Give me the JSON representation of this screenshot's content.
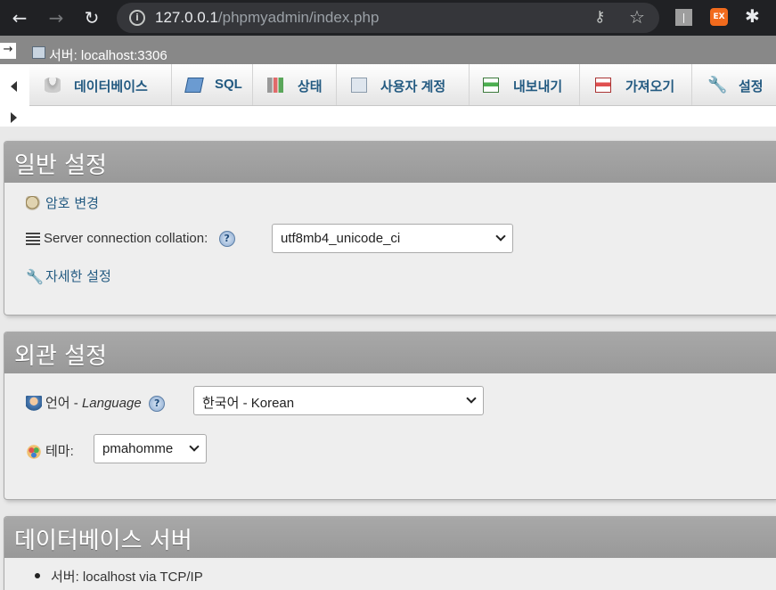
{
  "browser": {
    "url_host": "127.0.0.1",
    "url_path": "/phpmyadmin/index.php",
    "ext_badge": "EX"
  },
  "serverbar": {
    "collapse_glyph": "→",
    "label": "서버: localhost:3306"
  },
  "tabs": [
    {
      "label": "데이터베이스",
      "icon": "database-icon"
    },
    {
      "label": "SQL",
      "icon": "sql-icon"
    },
    {
      "label": "상태",
      "icon": "status-icon"
    },
    {
      "label": "사용자 계정",
      "icon": "user-accounts-icon"
    },
    {
      "label": "내보내기",
      "icon": "export-icon"
    },
    {
      "label": "가져오기",
      "icon": "import-icon"
    },
    {
      "label": "설정",
      "icon": "settings-wrench-icon"
    }
  ],
  "general": {
    "title": "일반 설정",
    "change_password": "암호 변경",
    "collation_label": "Server connection collation:",
    "collation_value": "utf8mb4_unicode_ci",
    "more_settings": "자세한 설정"
  },
  "appearance": {
    "title": "외관 설정",
    "language_label": "언어 - ",
    "language_label_en": "Language",
    "language_value": "한국어 - Korean",
    "theme_label": "테마:",
    "theme_value": "pmahomme"
  },
  "db_server": {
    "title": "데이터베이스 서버",
    "items": [
      "서버: localhost via TCP/IP"
    ]
  }
}
